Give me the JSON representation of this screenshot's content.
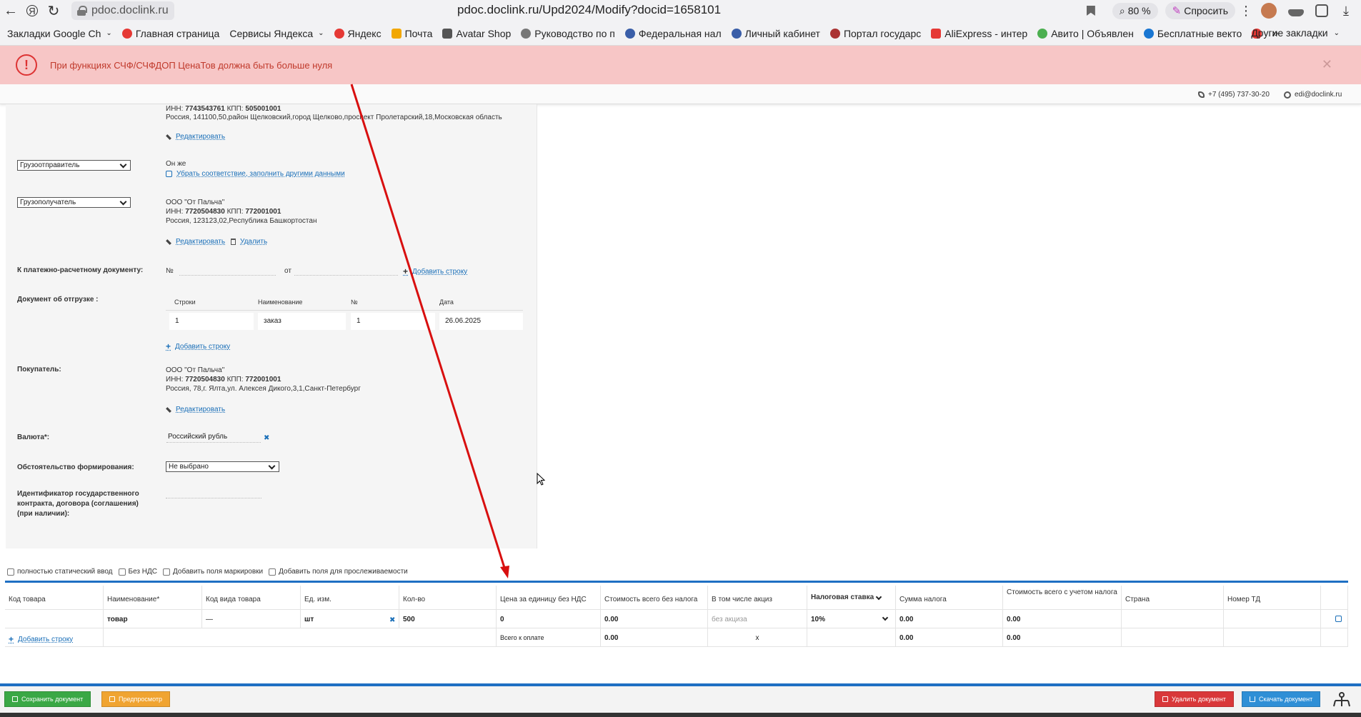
{
  "browser": {
    "domain_pill": "pdoc.doclink.ru",
    "address": "pdoc.doclink.ru/Upd2024/Modify?docid=1658101",
    "zoom": "80 %",
    "ask_label": "Спросить"
  },
  "bookmarks": [
    {
      "label": "Закладки Google Ch",
      "color": "#888",
      "chevron": true
    },
    {
      "label": "Главная страница",
      "color": "#e53935",
      "chevron": false
    },
    {
      "label": "Сервисы Яндекса",
      "color": "",
      "chevron": true
    },
    {
      "label": "Яндекс",
      "color": "#e53935",
      "chevron": false
    },
    {
      "label": "Почта",
      "color": "#f2a700",
      "chevron": false
    },
    {
      "label": "Avatar Shop",
      "color": "#555",
      "chevron": false
    },
    {
      "label": "Руководство по п",
      "color": "#777",
      "chevron": false
    },
    {
      "label": "Федеральная нал",
      "color": "#3a5ea8",
      "chevron": false
    },
    {
      "label": "Личный кабинет",
      "color": "#3a5ea8",
      "chevron": false
    },
    {
      "label": "Портал государс",
      "color": "#a33",
      "chevron": false
    },
    {
      "label": "AliExpress - интер",
      "color": "#e53935",
      "chevron": false
    },
    {
      "label": "Авито | Объявлен",
      "color": "#4caf50",
      "chevron": false
    },
    {
      "label": "Бесплатные векто",
      "color": "#1976d2",
      "chevron": false
    }
  ],
  "bookmarks_other": "Другие закладки",
  "alert": {
    "text": "При функциях СЧФ/СЧФДОП ЦенаТов должна быть больше нуля",
    "close": "✕"
  },
  "contacts": {
    "phone": "+7 (495) 737-30-20",
    "email": "edi@doclink.ru"
  },
  "seller": {
    "inn_line_prefix": "ИНН: ",
    "inn": "7743543761",
    "kpp_prefix": " КПП: ",
    "kpp": "505001001",
    "address": "Россия, 141100,50,район Щелковский,город Щелково,проспект Пролетарский,18,Московская область",
    "edit": "Редактировать"
  },
  "consignor": {
    "select": "Грузоотправитель",
    "value": "Он же",
    "link": "Убрать соответствие, заполнить другими данными"
  },
  "consignee": {
    "select": "Грузополучатель",
    "name": "ООО \"От Пальча\"",
    "inn_prefix": "ИНН: ",
    "inn": "7720504830",
    "kpp_prefix": " КПП: ",
    "kpp": "772001001",
    "address": "Россия, 123123,02,Республика Башкортостан",
    "edit": "Редактировать",
    "delete": "Удалить"
  },
  "payment_doc": {
    "label": "К платежно-расчетному документу:",
    "num_label": "№",
    "from_label": "от",
    "add": "Добавить строку"
  },
  "shipping_doc": {
    "label": "Документ об отгрузке :",
    "headers": [
      "Строки",
      "Наименование",
      "№",
      "Дата"
    ],
    "row": [
      "1",
      "заказ",
      "1",
      "26.06.2025"
    ],
    "add": "Добавить строку"
  },
  "buyer": {
    "label": "Покупатель:",
    "name": "ООО \"От Пальча\"",
    "inn_prefix": "ИНН: ",
    "inn": "7720504830",
    "kpp_prefix": " КПП: ",
    "kpp": "772001001",
    "address": "Россия, 78,г. Ялта,ул. Алексея Дикого,3,1,Санкт-Петербург",
    "edit": "Редактировать"
  },
  "currency": {
    "label": "Валюта*:",
    "value": "Российский рубль",
    "clear": "✖"
  },
  "circumstance": {
    "label": "Обстоятельство формирования:",
    "value": "Не выбрано"
  },
  "gov_contract": {
    "label_1": "Идентификатор государственного",
    "label_2": "контракта, договора (соглашения)",
    "label_3": "(при наличии):"
  },
  "options": [
    "полностью статический ввод",
    "Без НДС",
    "Добавить поля маркировки",
    "Добавить поля для прослеживаемости"
  ],
  "table": {
    "headers": [
      "Код товара",
      "Наименование*",
      "Код вида товара",
      "Ед. изм.",
      "Кол-во",
      "Цена за единицу без НДС",
      "Стоимость всего без налога",
      "В том числе акциз",
      "Налоговая ставка",
      "Сумма налога",
      "Стоимость всего с учетом налога",
      "Страна",
      "Номер ТД"
    ],
    "row": {
      "code": "",
      "name": "товар",
      "kind": "—",
      "unit": "шт",
      "unit_clear": "✖",
      "qty": "500",
      "price": "0",
      "total_no_tax": "0.00",
      "excise": "без акциза",
      "tax_rate": "10%",
      "tax_sum": "0.00",
      "total_with_tax": "0.00",
      "country": "",
      "td": ""
    },
    "footer": {
      "add": "Добавить строку",
      "total_label": "Всего к оплате",
      "total_no_tax": "0.00",
      "excise": "х",
      "tax_sum": "0.00",
      "total_with_tax": "0.00"
    }
  },
  "footer": {
    "save": "Сохранить документ",
    "preview": "Предпросмотр",
    "delete": "Удалить документ",
    "download": "Скачать документ"
  },
  "colors": {
    "alert_bg": "#f7c6c6",
    "alert_text": "#c0392b",
    "link": "#1a6fb8",
    "accent_blue": "#1e6fc3",
    "save_green": "#3aa845",
    "preview_orange": "#f0a431",
    "delete_red": "#d9383a",
    "download_blue": "#2f8fd6",
    "annotation_red": "#d80f0f"
  }
}
